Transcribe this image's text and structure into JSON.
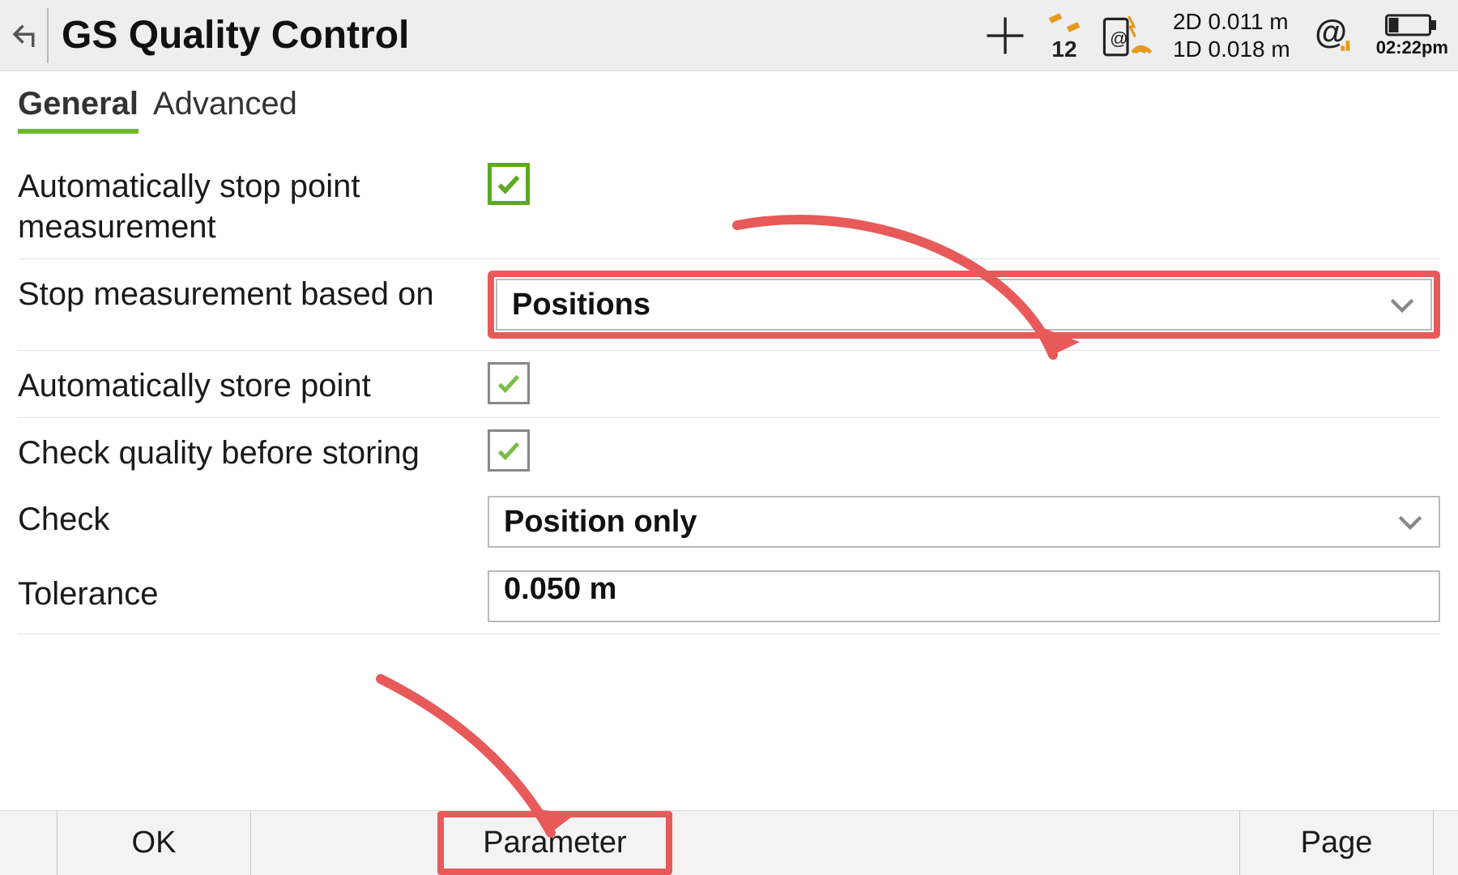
{
  "header": {
    "title": "GS Quality Control",
    "satellites": "12",
    "accuracy2d": "2D 0.011 m",
    "accuracy1d": "1D 0.018 m",
    "time": "02:22pm"
  },
  "tabs": {
    "general": "General",
    "advanced": "Advanced"
  },
  "rows": {
    "auto_stop_label": "Automatically stop point measurement",
    "stop_based_label": "Stop measurement based on",
    "stop_based_value": "Positions",
    "auto_store_label": "Automatically store point",
    "check_quality_label": "Check quality before storing",
    "check_label": "Check",
    "check_value": "Position only",
    "tolerance_label": "Tolerance",
    "tolerance_value": "0.050 m"
  },
  "bottom": {
    "ok": "OK",
    "parameter": "Parameter",
    "page": "Page"
  }
}
